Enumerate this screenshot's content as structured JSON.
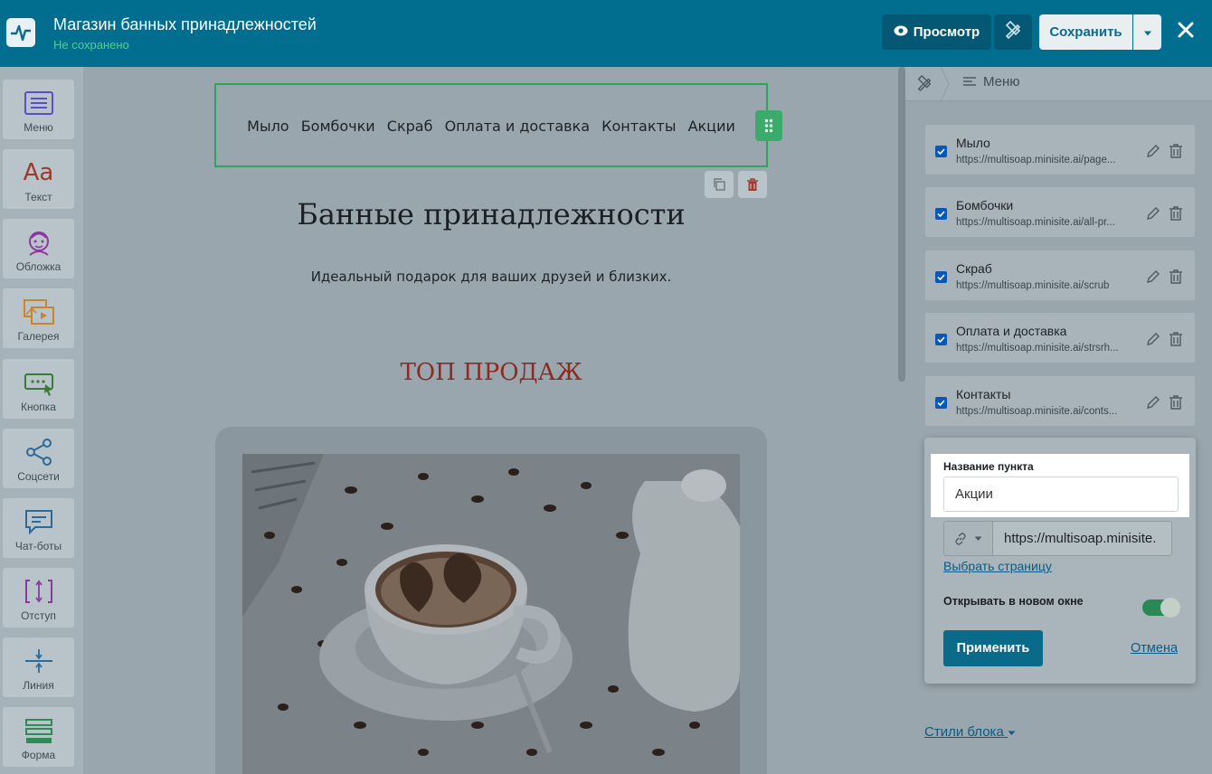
{
  "header": {
    "title": "Магазин банных принадлежностей",
    "status": "Не сохранено",
    "preview_label": "Просмотр",
    "save_label": "Сохранить"
  },
  "sidebar": {
    "tools": [
      {
        "label": "Меню",
        "icon": "menu-icon"
      },
      {
        "label": "Текст",
        "icon": "text-icon"
      },
      {
        "label": "Обложка",
        "icon": "cover-icon"
      },
      {
        "label": "Галерея",
        "icon": "gallery-icon"
      },
      {
        "label": "Кнопка",
        "icon": "button-icon"
      },
      {
        "label": "Соцсети",
        "icon": "share-icon"
      },
      {
        "label": "Чат-боты",
        "icon": "chat-icon"
      },
      {
        "label": "Отступ",
        "icon": "spacing-icon"
      },
      {
        "label": "Линия",
        "icon": "divider-icon"
      },
      {
        "label": "Форма",
        "icon": "form-icon"
      }
    ],
    "text_icon_glyph": "Aa"
  },
  "canvas": {
    "nav": [
      "Мыло",
      "Бомбочки",
      "Скраб",
      "Оплата и доставка",
      "Контакты",
      "Акции"
    ],
    "heading": "Банные принадлежности",
    "subheading": "Идеальный подарок для ваших друзей и близких.",
    "section_title": "ТОП ПРОДАЖ"
  },
  "panel": {
    "breadcrumb": "Меню",
    "items": [
      {
        "title": "Мыло",
        "url": "https://multisoap.minisite.ai/page..."
      },
      {
        "title": "Бомбочки",
        "url": "https://multisoap.minisite.ai/all-pr..."
      },
      {
        "title": "Скраб",
        "url": "https://multisoap.minisite.ai/scrub"
      },
      {
        "title": "Оплата и доставка",
        "url": "https://multisoap.minisite.ai/strsrh..."
      },
      {
        "title": "Контакты",
        "url": "https://multisoap.minisite.ai/conts..."
      }
    ],
    "styles_label": "Стили блока"
  },
  "popover": {
    "name_label": "Название пункта",
    "name_value": "Акции",
    "url_value": "https://multisoap.minisite.",
    "pick_page_label": "Выбрать страницу",
    "new_window_label": "Открывать в новом окне",
    "new_window_on": true,
    "apply_label": "Применить",
    "cancel_label": "Отмена"
  },
  "colors": {
    "topbar": "#016e8f",
    "accent_green": "#3aab6a",
    "heading_red": "#8d2a22",
    "link_blue": "#0b5b86"
  }
}
